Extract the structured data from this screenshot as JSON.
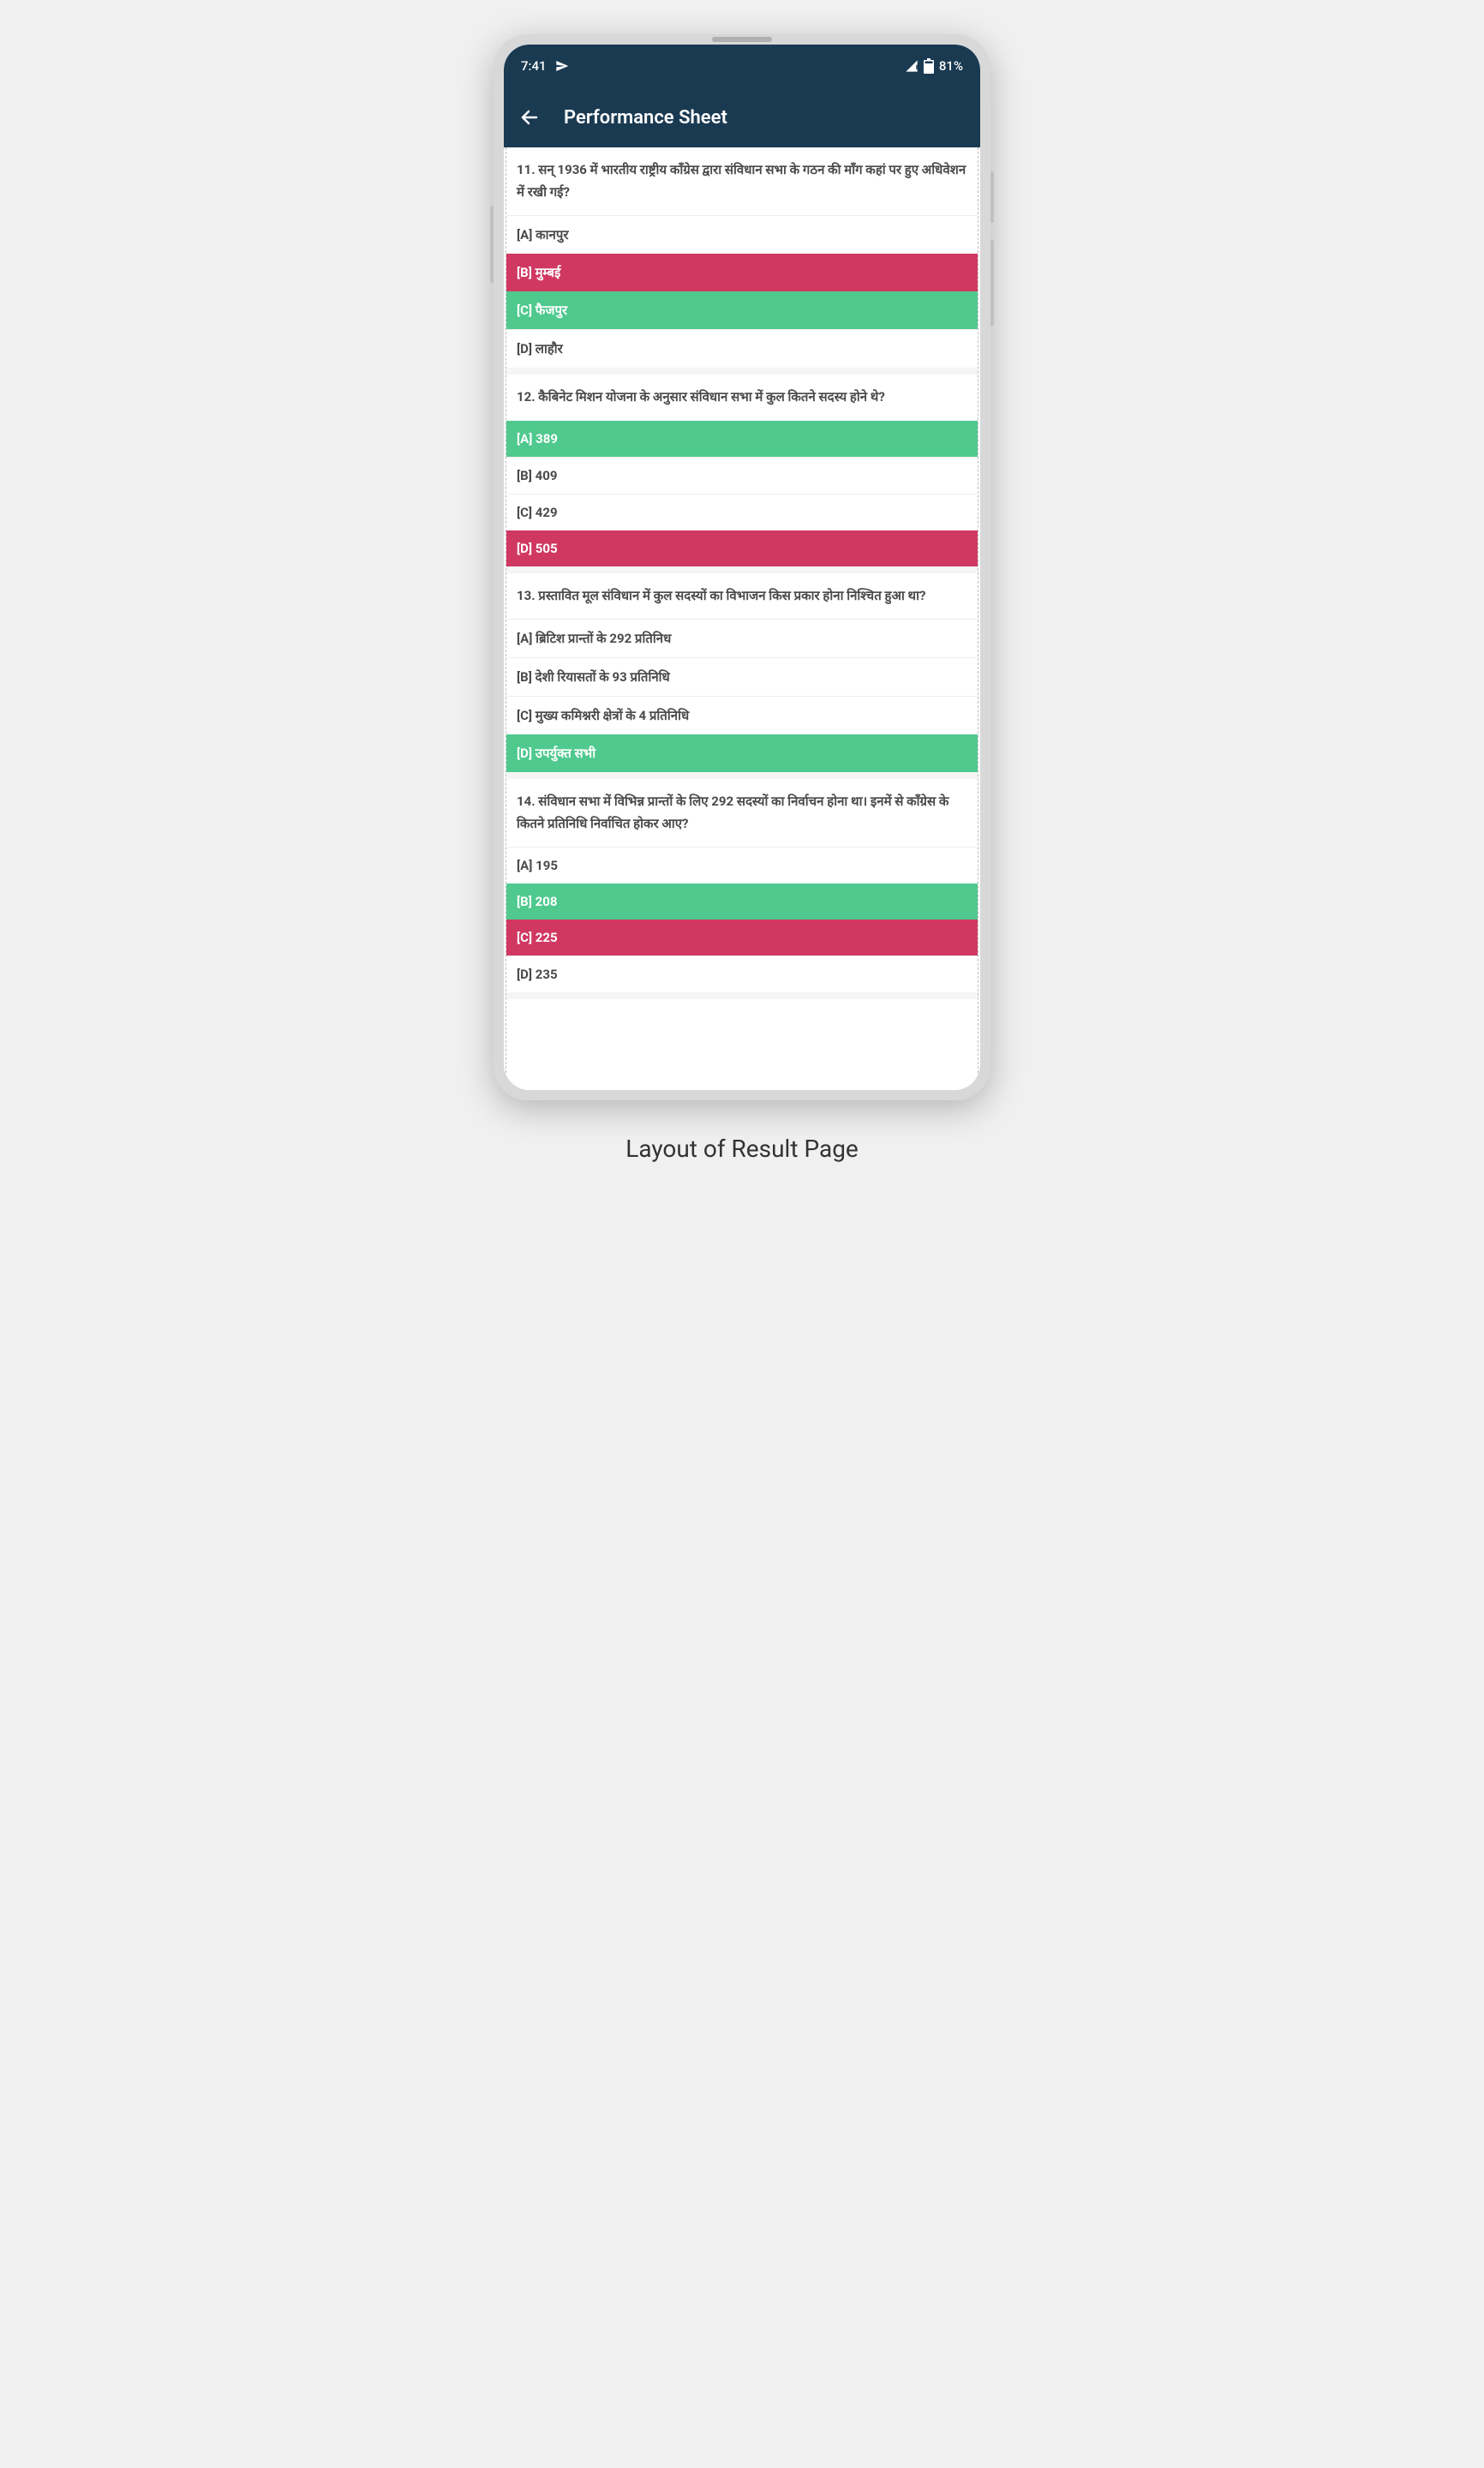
{
  "status": {
    "time": "7:41",
    "battery": "81%"
  },
  "header": {
    "title": "Performance Sheet"
  },
  "questions": [
    {
      "q": "11. सन् 1936 में भारतीय राष्ट्रीय काँग्रेस द्वारा संविधान सभा के गठन की माँग कहां पर हुए अधिवेशन में रखी गई?",
      "options": [
        {
          "label": "[A] कानपुर",
          "state": "plain"
        },
        {
          "label": "[B] मुम्बई",
          "state": "wrong"
        },
        {
          "label": "[C] फैजपुर",
          "state": "correct"
        },
        {
          "label": "[D] लाहौर",
          "state": "plain"
        }
      ]
    },
    {
      "q": "12. कैबिनेट मिशन योजना के अनुसार संविधान सभा में कुल कितने सदस्य होने थे?",
      "options": [
        {
          "label": "[A] 389",
          "state": "correct"
        },
        {
          "label": "[B] 409",
          "state": "plain"
        },
        {
          "label": "[C] 429",
          "state": "plain"
        },
        {
          "label": "[D] 505",
          "state": "wrong"
        }
      ]
    },
    {
      "q": "13. प्रस्तावित मूल संविधान में कुल सदस्यों का विभाजन किस प्रकार होना निश्चित हुआ था?",
      "options": [
        {
          "label": "[A] ब्रिटिश प्रान्तों के 292 प्रतिनिध",
          "state": "plain"
        },
        {
          "label": "[B] देशी रियासतों के 93 प्रतिनिधि",
          "state": "plain"
        },
        {
          "label": "[C] मुख्य कमिश्नरी क्षेत्रों के 4 प्रतिनिधि",
          "state": "plain"
        },
        {
          "label": "[D] उपर्युक्त सभी",
          "state": "correct"
        }
      ]
    },
    {
      "q": "14. संविधान सभा में विभिन्न प्रान्तों के लिए 292 सदस्यों का निर्वाचन होना था। इनमें से काँग्रेस के कितने प्रतिनिधि निर्वाचित होकर आए?",
      "options": [
        {
          "label": "[A] 195",
          "state": "plain"
        },
        {
          "label": "[B] 208",
          "state": "correct"
        },
        {
          "label": "[C] 225",
          "state": "wrong"
        },
        {
          "label": "[D] 235",
          "state": "plain"
        }
      ]
    }
  ],
  "caption": "Layout of Result Page"
}
